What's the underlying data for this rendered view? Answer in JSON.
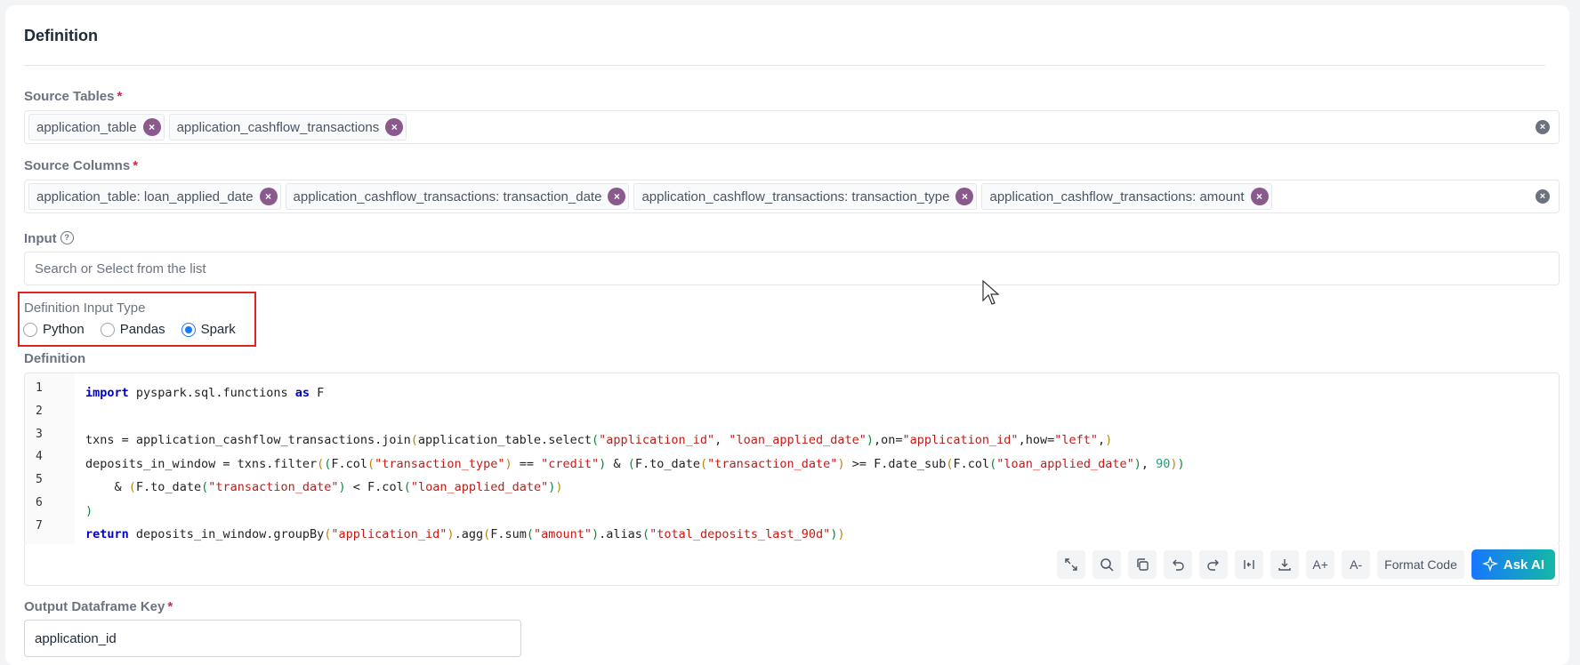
{
  "section": {
    "title": "Definition"
  },
  "source_tables": {
    "label": "Source Tables",
    "required_mark": "*",
    "chips": [
      "application_table",
      "application_cashflow_transactions"
    ],
    "chip_remove_glyph": "×",
    "clear_glyph": "×"
  },
  "source_columns": {
    "label": "Source Columns",
    "required_mark": "*",
    "chips": [
      "application_table: loan_applied_date",
      "application_cashflow_transactions: transaction_date",
      "application_cashflow_transactions: transaction_type",
      "application_cashflow_transactions: amount"
    ],
    "chip_remove_glyph": "×",
    "clear_glyph": "×"
  },
  "input": {
    "label": "Input",
    "help_glyph": "?",
    "placeholder": "Search or Select from the list"
  },
  "definition_input_type": {
    "label": "Definition Input Type",
    "options": [
      "Python",
      "Pandas",
      "Spark"
    ],
    "selected": "Spark"
  },
  "definition": {
    "label": "Definition",
    "line_numbers": [
      "1",
      "2",
      "3",
      "4",
      "5",
      "6",
      "7"
    ],
    "code_lines": [
      "import pyspark.sql.functions as F",
      "",
      "txns = application_cashflow_transactions.join(application_table.select(\"application_id\", \"loan_applied_date\"),on=\"application_id\",how=\"left\",)",
      "deposits_in_window = txns.filter((F.col(\"transaction_type\") == \"credit\") & (F.to_date(\"transaction_date\") >= F.date_sub(F.col(\"loan_applied_date\"), 90))",
      "    & (F.to_date(\"transaction_date\") < F.col(\"loan_applied_date\"))",
      ")",
      "return deposits_in_window.groupBy(\"application_id\").agg(F.sum(\"amount\").alias(\"total_deposits_last_90d\"))"
    ]
  },
  "toolbar": {
    "icons": [
      "expand-icon",
      "search-icon",
      "copy-icon",
      "undo-icon",
      "redo-icon",
      "split-icon",
      "download-icon",
      "font-increase-icon",
      "font-decrease-icon"
    ],
    "font_increase": "A+",
    "font_decrease": "A-",
    "format_code": "Format Code",
    "ask_ai": "Ask AI"
  },
  "output_key": {
    "label": "Output Dataframe Key",
    "required_mark": "*",
    "value": "application_id"
  },
  "colors": {
    "accent": "#1677ff",
    "chip_remove": "#8b5a8c",
    "highlight_border": "#e02424",
    "ask_ai_gradient_end": "#14b8a6"
  }
}
